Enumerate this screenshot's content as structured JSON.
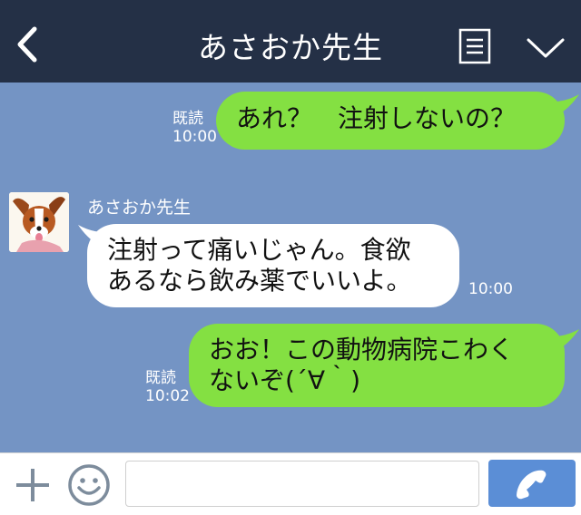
{
  "header": {
    "title": "あさおか先生"
  },
  "messages": [
    {
      "direction": "out",
      "text": "あれ？　注射しないの？",
      "read_label": "既読",
      "time": "10:00"
    },
    {
      "direction": "in",
      "sender": "あさおか先生",
      "lines": [
        "注射って痛いじゃん。食欲",
        "あるなら飲み薬でいいよ。"
      ],
      "time": "10:00"
    },
    {
      "direction": "out",
      "lines": [
        "おお！この動物病院こわく",
        "ないぞ(´∀｀)"
      ],
      "read_label": "既読",
      "time": "10:02"
    }
  ],
  "footer": {
    "input_value": ""
  },
  "colors": {
    "header_bg": "#243046",
    "chat_bg": "#7494c4",
    "outgoing_bubble": "#84e042",
    "incoming_bubble": "#ffffff",
    "call_button": "#5b8ed6"
  },
  "icons": [
    "back-chevron-icon",
    "menu-icon",
    "chevron-down-icon",
    "plus-icon",
    "emoji-icon",
    "phone-icon"
  ]
}
